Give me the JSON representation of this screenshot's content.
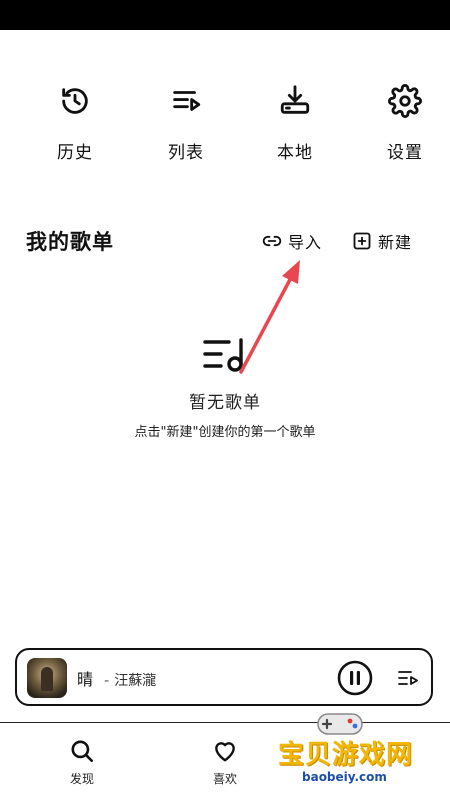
{
  "quick_actions": [
    {
      "label": "历史",
      "icon": "history-icon"
    },
    {
      "label": "列表",
      "icon": "playlist-icon"
    },
    {
      "label": "本地",
      "icon": "download-icon"
    },
    {
      "label": "设置",
      "icon": "gear-icon"
    }
  ],
  "playlists_section": {
    "title": "我的歌单",
    "import_label": "导入",
    "new_label": "新建"
  },
  "empty_state": {
    "title": "暂无歌单",
    "hint": "点击\"新建\"创建你的第一个歌单"
  },
  "mini_player": {
    "title": "晴",
    "separator": "-",
    "artist": "汪蘇瀧",
    "state": "playing"
  },
  "bottom_nav": [
    {
      "label": "发现",
      "icon": "search-icon"
    },
    {
      "label": "喜欢",
      "icon": "heart-icon"
    }
  ],
  "watermark": {
    "text": "宝贝游戏网",
    "url": "baobeiy.com"
  },
  "colors": {
    "annotation_arrow": "#e8474f",
    "watermark_yellow": "#f2b705",
    "watermark_blue": "#1d4fa8"
  }
}
